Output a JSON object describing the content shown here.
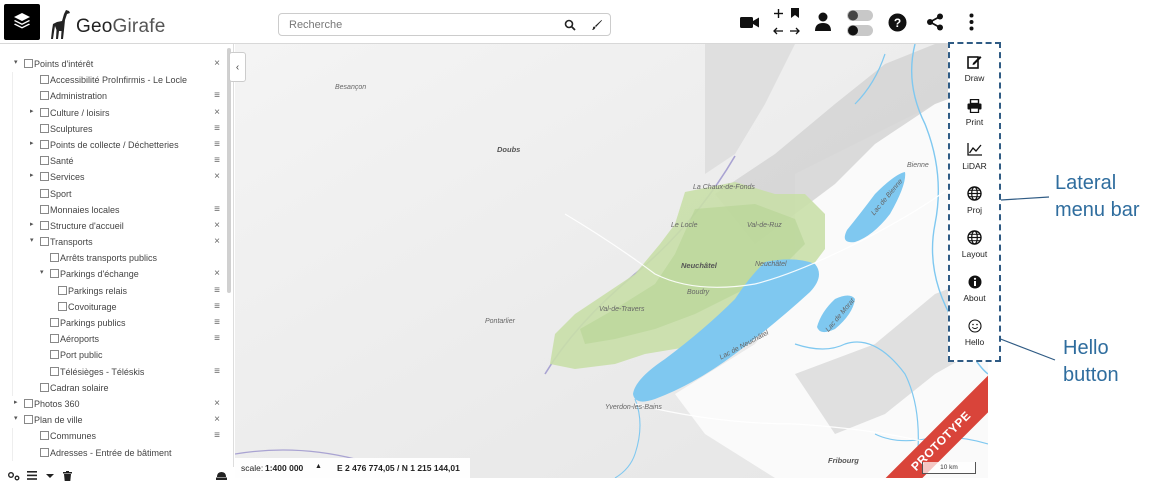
{
  "header": {
    "logo_main": "Geo",
    "logo_light": "Girafe",
    "search_placeholder": "Recherche"
  },
  "icons": {
    "layers": "layers-icon",
    "search": "search-icon",
    "draw": "brush-icon",
    "video": "video-camera-icon",
    "zoom": "plus-icon",
    "bookmark": "bookmark-icon",
    "back": "arrow-left-icon",
    "forward": "arrow-right-icon",
    "user": "user-icon",
    "toggle": "toggle-icon",
    "help": "question-icon",
    "share": "share-icon",
    "more": "more-vertical-icon"
  },
  "colors": {
    "accent": "#2f5b84",
    "annotation": "#2f6d9e",
    "prototype": "#d9443a",
    "water": "#7fc8f0",
    "forest": "#c9dfa9"
  },
  "tree": [
    {
      "label": "Points d'intérêt",
      "level": 0,
      "arrow": "down",
      "action": "×"
    },
    {
      "label": "Accessibilité ProInfirmis - Le Locle",
      "level": 1,
      "arrow": "",
      "action": ""
    },
    {
      "label": "Administration",
      "level": 1,
      "arrow": "",
      "action": "≡"
    },
    {
      "label": "Culture / loisirs",
      "level": 1,
      "arrow": "right",
      "action": "×"
    },
    {
      "label": "Sculptures",
      "level": 1,
      "arrow": "",
      "action": "≡"
    },
    {
      "label": "Points de collecte / Déchetteries",
      "level": 1,
      "arrow": "right",
      "action": "≡"
    },
    {
      "label": "Santé",
      "level": 1,
      "arrow": "",
      "action": "≡"
    },
    {
      "label": "Services",
      "level": 1,
      "arrow": "right",
      "action": "×"
    },
    {
      "label": "Sport",
      "level": 1,
      "arrow": "",
      "action": ""
    },
    {
      "label": "Monnaies locales",
      "level": 1,
      "arrow": "",
      "action": "≡"
    },
    {
      "label": "Structure d'accueil",
      "level": 1,
      "arrow": "right",
      "action": "×"
    },
    {
      "label": "Transports",
      "level": 1,
      "arrow": "down",
      "action": "×"
    },
    {
      "label": "Arrêts transports publics",
      "level": 2,
      "arrow": "",
      "action": ""
    },
    {
      "label": "Parkings d'échange",
      "level": 2,
      "arrow": "down",
      "action": "×"
    },
    {
      "label": "Parkings relais",
      "level": 3,
      "arrow": "",
      "action": "≡"
    },
    {
      "label": "Covoiturage",
      "level": 3,
      "arrow": "",
      "action": "≡"
    },
    {
      "label": "Parkings publics",
      "level": 2,
      "arrow": "",
      "action": "≡"
    },
    {
      "label": "Aéroports",
      "level": 2,
      "arrow": "",
      "action": "≡"
    },
    {
      "label": "Port public",
      "level": 2,
      "arrow": "",
      "action": ""
    },
    {
      "label": "Télésièges - Téléskis",
      "level": 2,
      "arrow": "",
      "action": "≡"
    },
    {
      "label": "Cadran solaire",
      "level": 1,
      "arrow": "",
      "action": ""
    },
    {
      "label": "Photos 360",
      "level": 0,
      "arrow": "right",
      "action": "×"
    },
    {
      "label": "Plan de ville",
      "level": 0,
      "arrow": "down",
      "action": "×"
    },
    {
      "label": "Communes",
      "level": 1,
      "arrow": "",
      "action": "≡"
    },
    {
      "label": "Adresses - Entrée de bâtiment",
      "level": 1,
      "arrow": "",
      "action": ""
    }
  ],
  "statusbar": {
    "scale_label": "scale:",
    "scale_value": "1:400 000",
    "scale_arrow": "▲",
    "coords": "E 2 476 774,05 / N 1 215 144,01"
  },
  "map": {
    "labels": [
      {
        "text": "Besançon",
        "bold": false
      },
      {
        "text": "Doubs",
        "bold": true
      },
      {
        "text": "La Chaux-de-Fonds",
        "bold": false
      },
      {
        "text": "Le Locle",
        "bold": false
      },
      {
        "text": "Neuchâtel",
        "bold": true
      },
      {
        "text": "Neuchâtel",
        "bold": false
      },
      {
        "text": "Pontarlier",
        "bold": false
      },
      {
        "text": "Val-de-Travers",
        "bold": false
      },
      {
        "text": "Boudry",
        "bold": false
      },
      {
        "text": "Lac de Neuchâtel",
        "bold": false
      },
      {
        "text": "Lac de Bienne",
        "bold": false
      },
      {
        "text": "Lac de Morat",
        "bold": false
      },
      {
        "text": "Yverdon-les-Bains",
        "bold": false
      },
      {
        "text": "Fribourg",
        "bold": true
      },
      {
        "text": "Bienne",
        "bold": false
      },
      {
        "text": "Val-de-Ruz",
        "bold": false
      }
    ],
    "prototype_label": "PROTOTYPE",
    "scale_bar": "10 km"
  },
  "lateral_menu": [
    {
      "label": "Draw",
      "icon": "edit-icon"
    },
    {
      "label": "Print",
      "icon": "printer-icon"
    },
    {
      "label": "LiDAR",
      "icon": "chart-line-icon"
    },
    {
      "label": "Proj",
      "icon": "globe-icon"
    },
    {
      "label": "Layout",
      "icon": "globe-icon"
    },
    {
      "label": "About",
      "icon": "info-icon"
    },
    {
      "label": "Hello",
      "icon": "smiley-icon"
    }
  ],
  "annotations": {
    "lateral_line1": "Lateral",
    "lateral_line2": "menu bar",
    "hello_line1": "Hello",
    "hello_line2": "button"
  }
}
